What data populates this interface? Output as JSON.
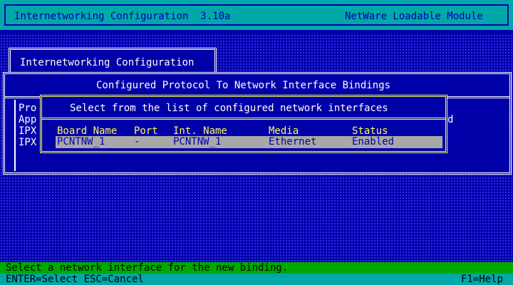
{
  "header": {
    "title": "Internetworking Configuration  3.10a",
    "module": "NetWare Loadable Module"
  },
  "main_window": {
    "title": "Internetworking Configuration"
  },
  "bindings_window": {
    "title": "Configured Protocol To Network Interface Bindings",
    "left_fragments": [
      "Pro",
      "App",
      "IPX",
      "IPX"
    ],
    "right_fragment": "d"
  },
  "interfaces_dialog": {
    "title": "Select from the list of configured network interfaces",
    "columns": [
      "Board Name",
      "Port",
      "Int. Name",
      "Media",
      "Status"
    ],
    "rows": [
      {
        "board_name": "PCNTNW_1",
        "port": "-",
        "int_name": "PCNTNW_1",
        "media": "Ethernet",
        "status": "Enabled"
      }
    ]
  },
  "status_bar": {
    "message": "Select a network interface for the new binding."
  },
  "key_bar": {
    "left": "ENTER=Select ESC=Cancel",
    "right": "F1=Help"
  },
  "colors": {
    "background": "#0000a8",
    "header": "#00a8a8",
    "highlight": "#fcfc54",
    "selection": "#a8a8a8",
    "status": "#00a800"
  }
}
